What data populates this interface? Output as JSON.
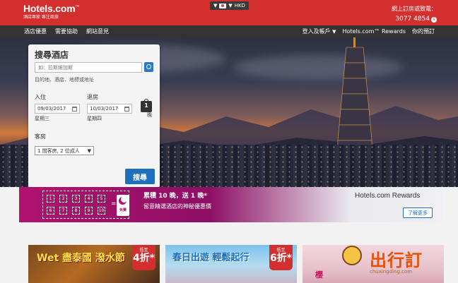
{
  "header": {
    "logo": "Hotels.com",
    "logo_trademark": "™",
    "tagline": "酒店專家 專注商旅",
    "locale": {
      "currency": "HKD"
    },
    "hotline": {
      "label": "網上訂房或致電：",
      "number": "3077 4854"
    }
  },
  "nav": {
    "left": [
      "酒店優惠",
      "需要協助",
      "網站意見"
    ],
    "right": {
      "account": "登入及帳戶",
      "rewards": "Hotels.com™ Rewards",
      "bookings": "你的預訂"
    }
  },
  "search": {
    "title": "搜尋酒店",
    "destination_placeholder": "如：拉斯維加斯",
    "destination_hint": "目的地、酒店、地標或地址",
    "checkin": {
      "label": "入住",
      "date": "09/03/2017",
      "day": "星期三"
    },
    "checkout": {
      "label": "退房",
      "date": "10/03/2017",
      "day": "星期四"
    },
    "nights": {
      "count": "1",
      "label": "晚"
    },
    "rooms": {
      "label": "客房",
      "value": "1 間客房, 2 位成人"
    },
    "button": "搜尋"
  },
  "rewards_banner": {
    "stamps": [
      "1",
      "2",
      "3",
      "4",
      "5",
      "6",
      "7",
      "8",
      "9",
      "10"
    ],
    "equals": "=",
    "free_label": "免費",
    "headline": "累積 10 晚，送 1 晚*",
    "subline": "留意精選酒店的神秘優惠價",
    "brand": "Hotels.com Rewards",
    "learn_more": "了解更多"
  },
  "promos": [
    {
      "title": "Wet 盡泰國 潑水節",
      "discount_prefix": "低至",
      "discount": "4折*"
    },
    {
      "title": "春日出遊 輕鬆起行",
      "discount_prefix": "低至",
      "discount": "6折*"
    },
    {
      "title": "櫻",
      "watermark": "出行訂",
      "watermark_url": "chuxingding.com"
    }
  ],
  "colors": {
    "brand_red": "#d32f2f",
    "nav_dark": "#333333",
    "button_blue": "#1f6fbf",
    "rewards_magenta": "#b0126e"
  }
}
